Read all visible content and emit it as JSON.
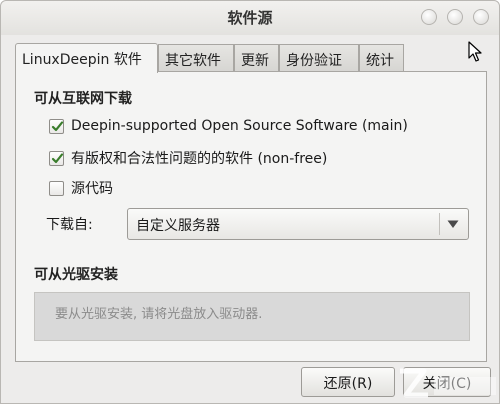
{
  "window": {
    "title": "软件源"
  },
  "tabs": [
    {
      "label": "LinuxDeepin 软件",
      "active": true
    },
    {
      "label": "其它软件"
    },
    {
      "label": "更新"
    },
    {
      "label": "身份验证"
    },
    {
      "label": "统计"
    }
  ],
  "internet": {
    "heading": "可从互联网下载",
    "options": [
      {
        "label": "Deepin-supported Open Source Software (main)",
        "checked": true
      },
      {
        "label": "有版权和合法性问题的的软件 (non-free)",
        "checked": true
      },
      {
        "label": "源代码",
        "checked": false
      }
    ],
    "download_from_label": "下载自:",
    "download_from_value": "自定义服务器"
  },
  "cdrom": {
    "heading": "可从光驱安装",
    "message": "要从光驱安装, 请将光盘放入驱动器."
  },
  "buttons": {
    "revert": "还原(R)",
    "close": "关闭(C)"
  },
  "icons": {
    "checkbox_check": "checkmark-icon",
    "combo_arrow": "triangle-down-icon",
    "cursor": "mouse-pointer-icon"
  },
  "colors": {
    "check": "#3a7d2c",
    "window_bg": "#edeceb",
    "panel_bg": "#f4f4f3"
  }
}
